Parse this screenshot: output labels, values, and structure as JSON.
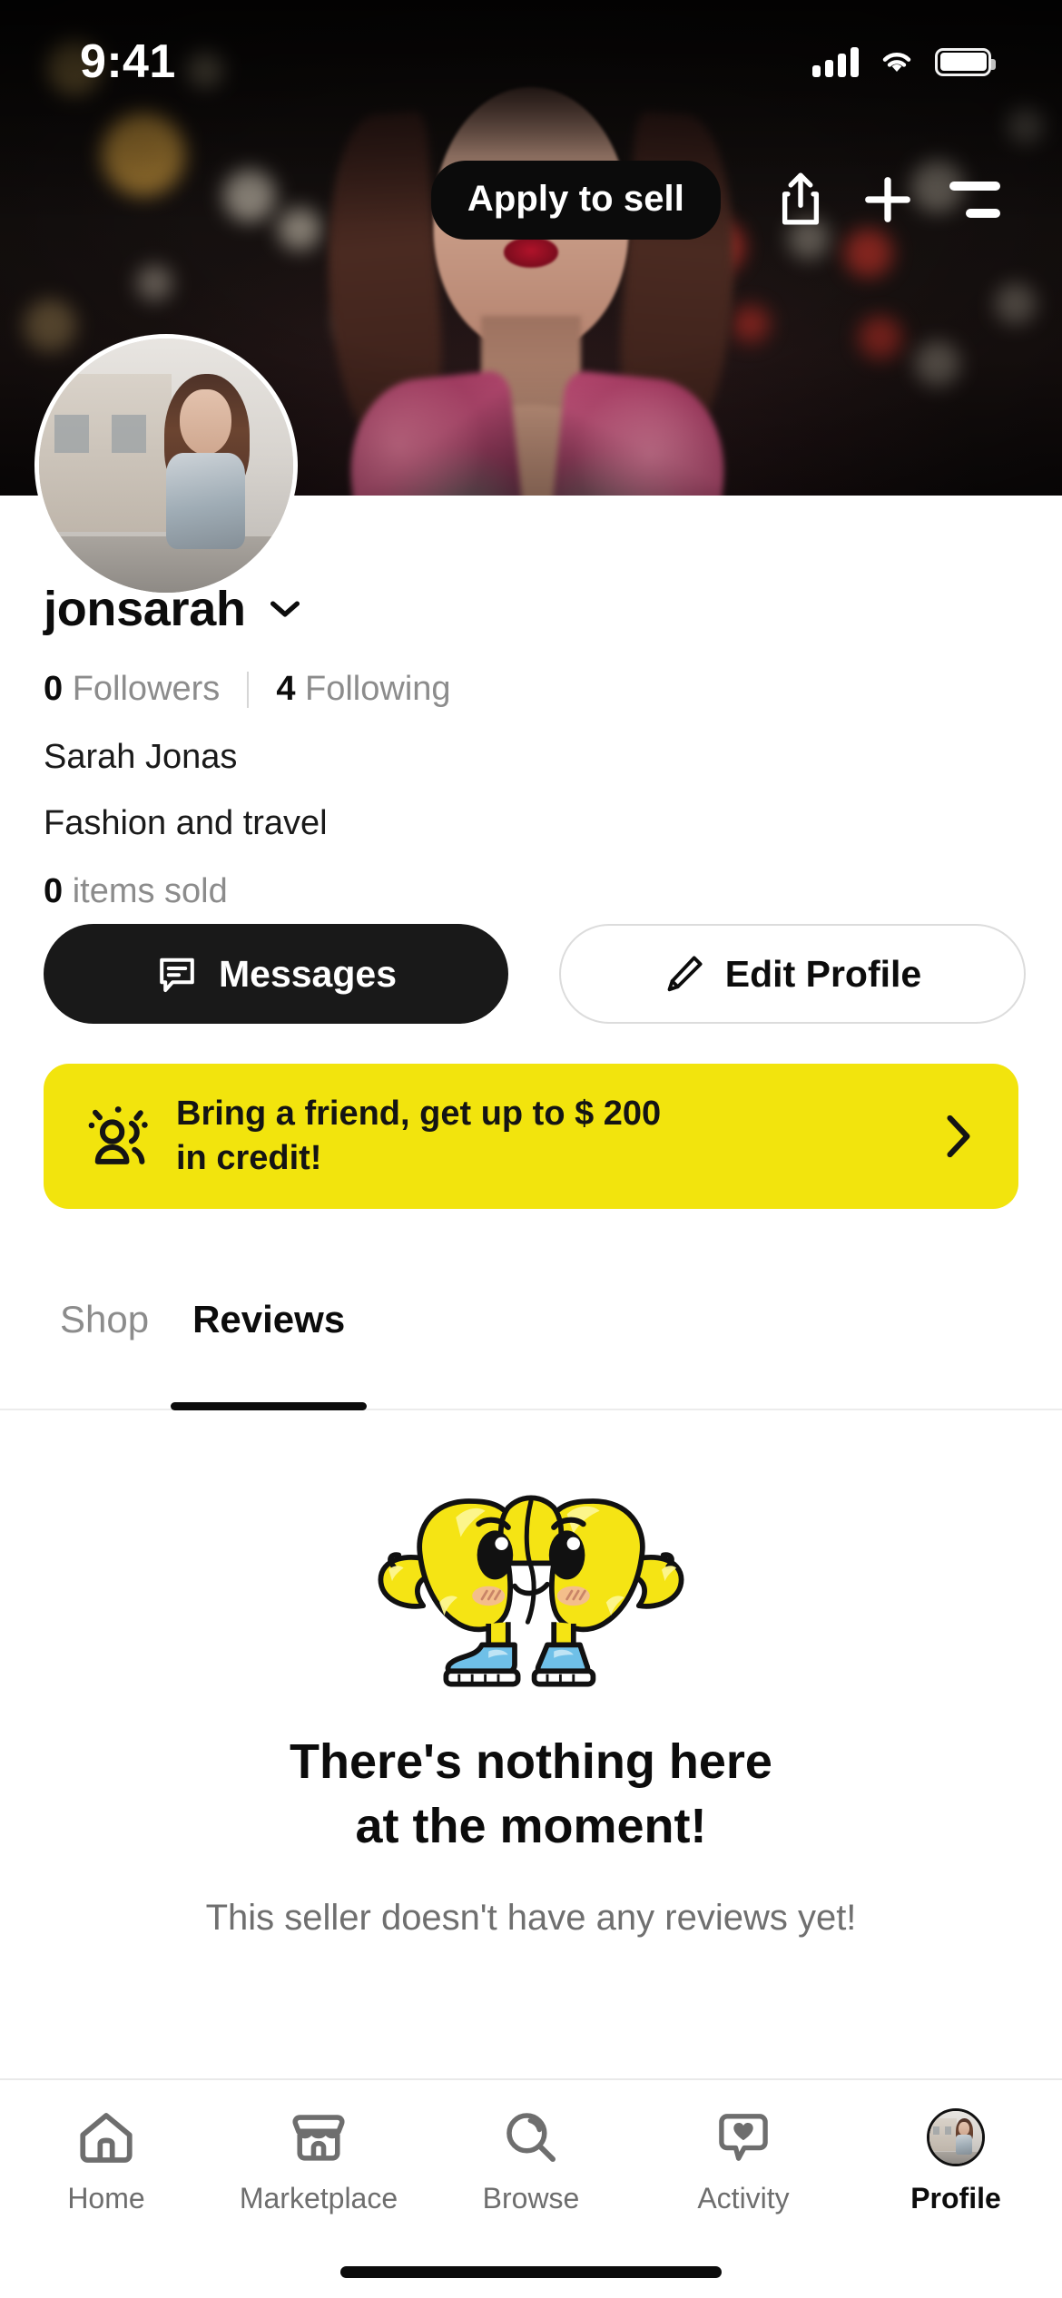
{
  "status_bar": {
    "time": "9:41",
    "icons": [
      "cellular-signal-icon",
      "wifi-icon",
      "battery-icon"
    ]
  },
  "header": {
    "apply_label": "Apply to sell",
    "actions": [
      {
        "name": "share-icon"
      },
      {
        "name": "plus-icon"
      },
      {
        "name": "menu-icon"
      }
    ]
  },
  "profile": {
    "username": "jonsarah",
    "chevron_icon": "chevron-down-icon",
    "followers_count": "0",
    "followers_label": "Followers",
    "following_count": "4",
    "following_label": "Following",
    "real_name": "Sarah Jonas",
    "bio": "Fashion and travel",
    "items_sold_count": "0",
    "items_sold_label": "items sold",
    "avatar_icon": "profile-avatar",
    "cover_photo": "cover-photo"
  },
  "actions": {
    "messages_label": "Messages",
    "messages_icon": "chat-bubble-icon",
    "edit_profile_label": "Edit Profile",
    "edit_profile_icon": "pencil-icon"
  },
  "referral": {
    "icon": "friends-icon",
    "line1": "Bring a friend, get up to $ 200",
    "line2": "in credit!",
    "chevron_icon": "chevron-right-icon",
    "background_color": "#F2E40D"
  },
  "tabs": [
    {
      "label": "Shop",
      "active": false
    },
    {
      "label": "Reviews",
      "active": true
    }
  ],
  "empty_state": {
    "illustration": "yellow-mascot-illustration",
    "title_line1": "There's nothing here",
    "title_line2": "at the moment!",
    "subtitle": "This seller doesn't have any reviews yet!"
  },
  "bottom_nav": [
    {
      "label": "Home",
      "icon": "home-icon",
      "active": false
    },
    {
      "label": "Marketplace",
      "icon": "storefront-icon",
      "active": false
    },
    {
      "label": "Browse",
      "icon": "search-icon",
      "active": false
    },
    {
      "label": "Activity",
      "icon": "heart-bubble-icon",
      "active": false
    },
    {
      "label": "Profile",
      "icon": "avatar-icon",
      "active": true
    }
  ]
}
